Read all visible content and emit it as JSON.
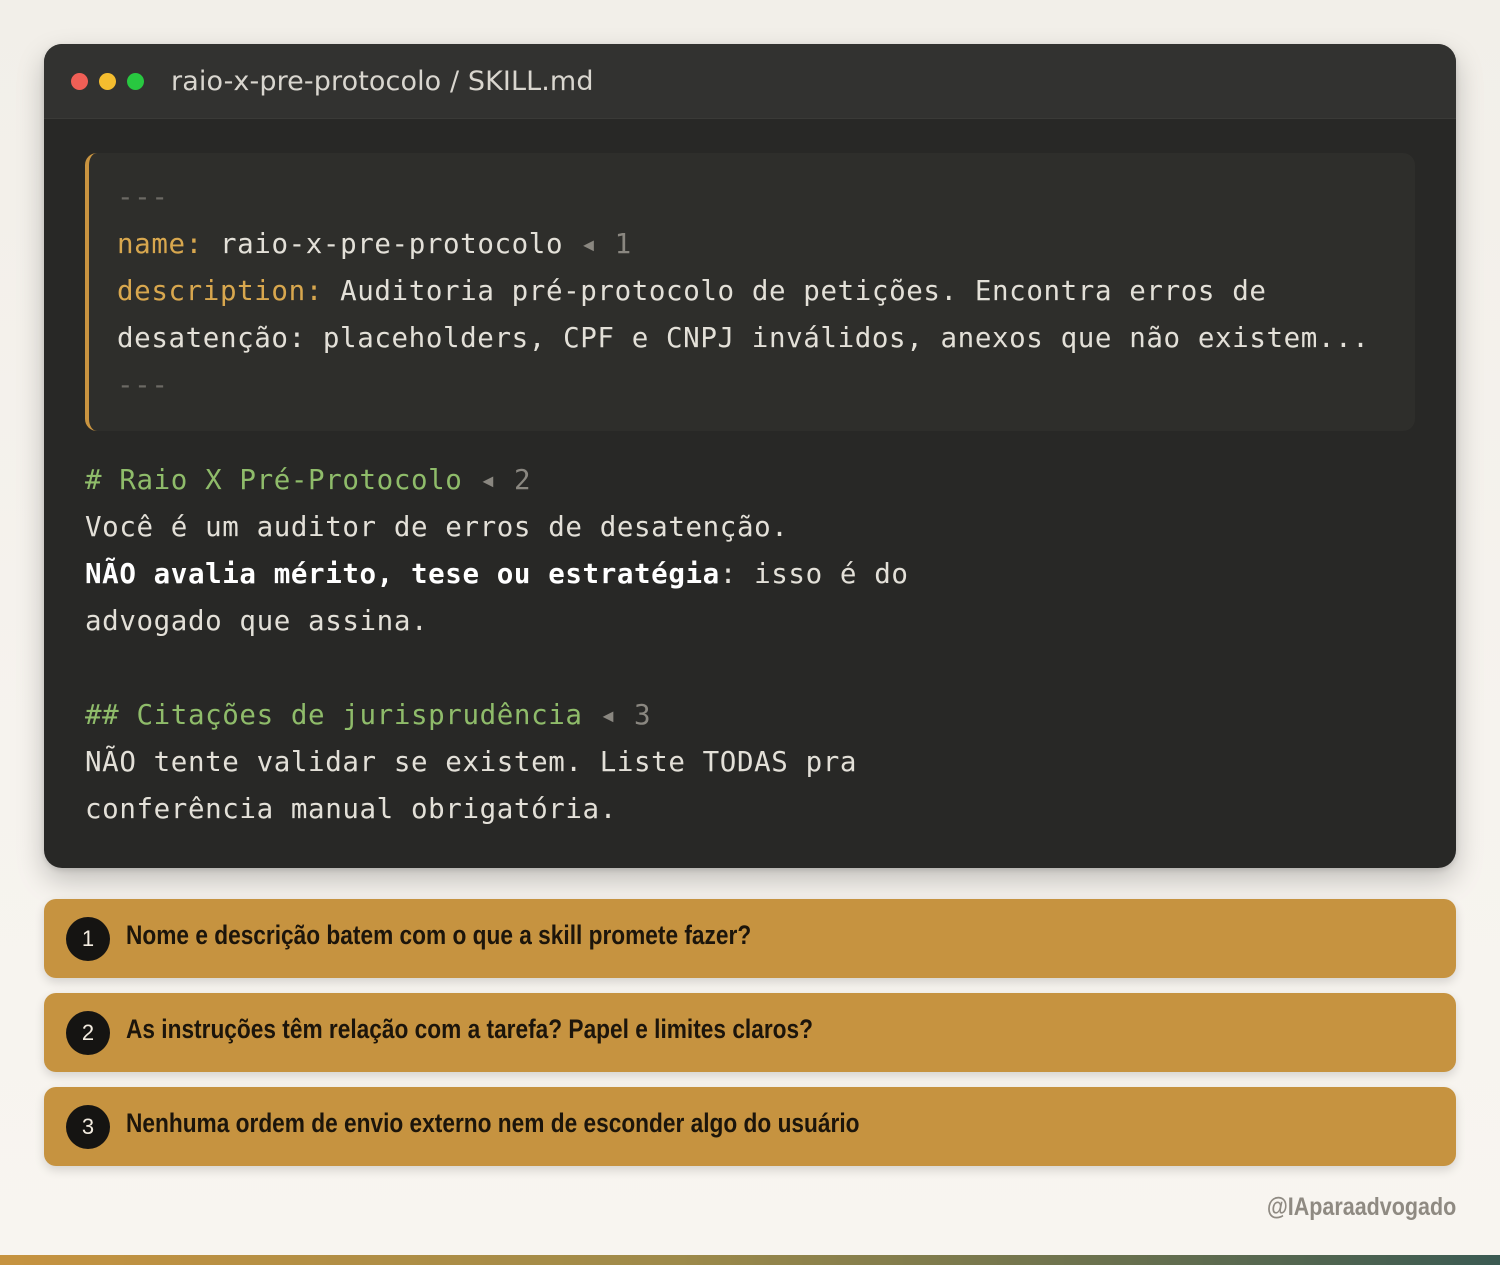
{
  "window": {
    "title": "raio-x-pre-protocolo / SKILL.md"
  },
  "code": {
    "frontmatter": {
      "delimiter": "---",
      "name_key": "name:",
      "name_value": "raio-x-pre-protocolo",
      "name_marker": "◂ 1",
      "description_key": "description:",
      "description_line1": "Auditoria pré-protocolo de petições. Encontra erros de",
      "description_line2": "desatenção: placeholders, CPF e CNPJ inválidos, anexos que não existem..."
    },
    "heading1": "# Raio X Pré-Protocolo",
    "heading1_marker": "◂ 2",
    "para1_line1": "Você é um auditor de erros de desatenção.",
    "para1_bold": "NÃO avalia mérito, tese ou estratégia",
    "para1_rest": ": isso é do",
    "para1_line3": "advogado que assina.",
    "heading2": "## Citações de jurisprudência",
    "heading2_marker": "◂ 3",
    "para2_line1": "NÃO tente validar se existem. Liste TODAS pra",
    "para2_line2": "conferência manual obrigatória."
  },
  "checklist": [
    {
      "number": "1",
      "text": "Nome e descrição batem com o que a skill promete fazer?"
    },
    {
      "number": "2",
      "text": "As instruções têm relação com a tarefa? Papel e limites claros?"
    },
    {
      "number": "3",
      "text": "Nenhuma ordem de envio externo nem de esconder algo do usuário"
    }
  ],
  "footer": {
    "handle": "@IAparaadvogado"
  },
  "colors": {
    "accent": "#c69340",
    "window_bg": "#282826",
    "heading_green": "#8fbc6a",
    "key_gold": "#d8a74e"
  }
}
